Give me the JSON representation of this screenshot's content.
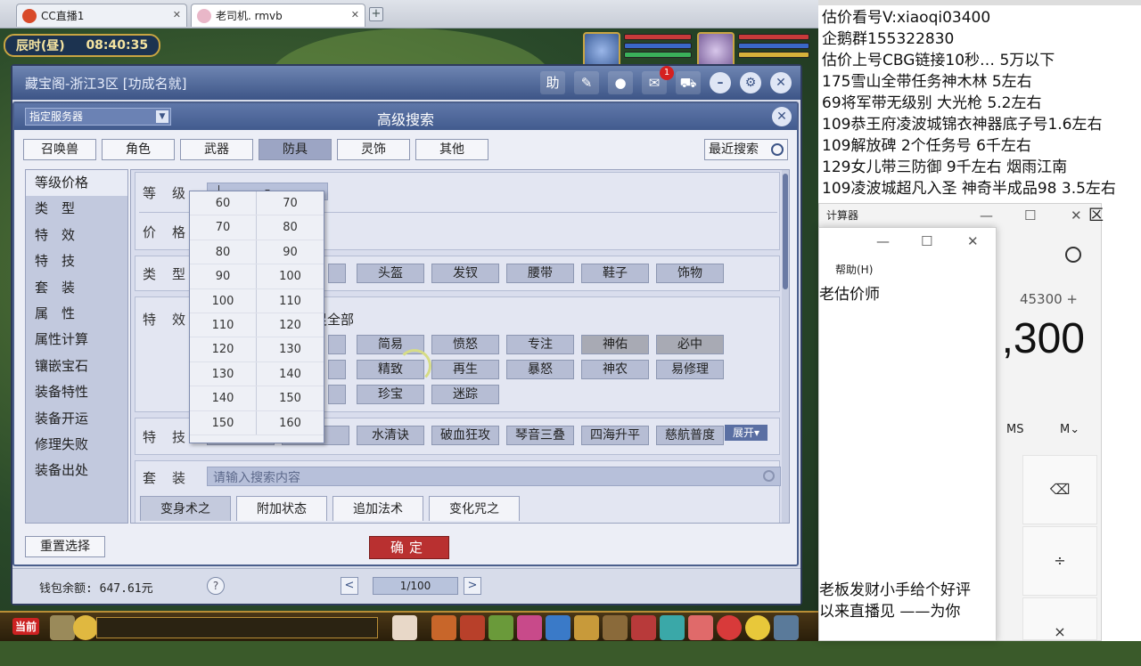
{
  "browser": {
    "tabs": [
      {
        "title": "CC直播1",
        "active": false
      },
      {
        "title": "老司机. rmvb",
        "active": true
      }
    ],
    "close_glyph": "✕",
    "new_tab_glyph": "+"
  },
  "game": {
    "time_period": "辰时(昼)",
    "clock": "08:40:35",
    "current_channel": "当前"
  },
  "cbg": {
    "title": "藏宝阁-浙江3区 [功成名就]",
    "tools": {
      "help": "助",
      "mail_badge": "1"
    },
    "footer": {
      "wallet": "钱包余额: 647.61元",
      "help_glyph": "?",
      "prev_glyph": "<",
      "next_glyph": ">",
      "page": "1/100"
    }
  },
  "advanced_search": {
    "title": "高级搜索",
    "server_select": "指定服务器",
    "close_glyph": "✕",
    "categories": [
      {
        "label": "召唤兽",
        "active": false
      },
      {
        "label": "角色",
        "active": false
      },
      {
        "label": "武器",
        "active": false
      },
      {
        "label": "防具",
        "active": true
      },
      {
        "label": "灵饰",
        "active": false
      },
      {
        "label": "其他",
        "active": false
      }
    ],
    "recent": "最近搜索",
    "left_nav": [
      "等级价格",
      "类　型",
      "特　效",
      "特　技",
      "套　装",
      "属　性",
      "属性计算",
      "镶嵌宝石",
      "装备特性",
      "装备开运",
      "修理失败",
      "装备出处"
    ],
    "level_label": "等级",
    "level_dash": "–",
    "price_label": "价格",
    "type_label": "类型",
    "types": [
      "头盔",
      "发钗",
      "腰带",
      "鞋子",
      "饰物"
    ],
    "effect_label": "特效",
    "effect_note": "足全部",
    "effects_row1": [
      {
        "label": "简易",
        "gray": false
      },
      {
        "label": "愤怒",
        "gray": false
      },
      {
        "label": "专注",
        "gray": false
      },
      {
        "label": "神佑",
        "gray": true
      },
      {
        "label": "必中",
        "gray": true
      }
    ],
    "effects_row2": [
      "精致",
      "再生",
      "暴怒",
      "神农",
      "易修理"
    ],
    "effects_row3": [
      "珍宝",
      "迷踪"
    ],
    "skill_label": "特技",
    "skills": [
      "水清诀",
      "破血狂攻",
      "琴音三叠",
      "四海升平",
      "慈航普度"
    ],
    "expand": "展开▾",
    "set_label": "套装",
    "set_placeholder": "请输入搜索内容",
    "subtabs": [
      "变身术之",
      "附加状态",
      "追加法术",
      "变化咒之"
    ],
    "reset": "重置选择",
    "confirm": "确定",
    "level_options": [
      [
        "60",
        "70"
      ],
      [
        "70",
        "80"
      ],
      [
        "80",
        "90"
      ],
      [
        "90",
        "100"
      ],
      [
        "100",
        "110"
      ],
      [
        "110",
        "120"
      ],
      [
        "120",
        "130"
      ],
      [
        "130",
        "140"
      ],
      [
        "140",
        "150"
      ],
      [
        "150",
        "160"
      ]
    ]
  },
  "notes": [
    "估价看号V:xiaoqi03400",
    "企鹅群155322830",
    "估价上号CBG链接10秒… 5万以下",
    "175雪山全带任务神木林 5左右",
    "69将军带无级别 大光枪 5.2左右",
    "109恭王府凌波城锦衣神器底子号1.6左右",
    "109解放碑 2个任务号 6千左右",
    "129女儿带三防御 9千左右 烟雨江南",
    "109凌波城超凡入圣 神奇半成品98 3.5左右"
  ],
  "calculator_back": {
    "title": "计算器",
    "expression": "45300 +",
    "value": ",300",
    "mem_ms": "MS",
    "mem_mv": "M⌄",
    "back_key": "⌫",
    "div_key": "÷",
    "mul_key": "×",
    "min_glyph": "—",
    "max_glyph": "☐",
    "close_glyph": "✕",
    "trailing": "区"
  },
  "calculator_front": {
    "menu_help": "帮助(H)",
    "label": "老估价师",
    "min_glyph": "—",
    "max_glyph": "☐",
    "close_glyph": "✕",
    "footer1": "老板发财小手给个好评",
    "footer2": "以来直播见 ——为你"
  }
}
